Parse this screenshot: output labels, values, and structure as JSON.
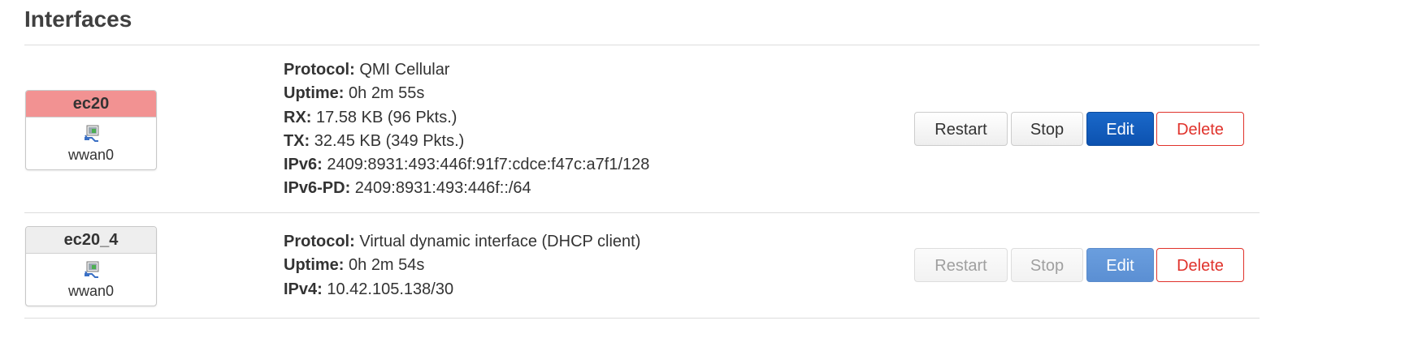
{
  "page": {
    "title": "Interfaces"
  },
  "interfaces": [
    {
      "name": "ec20",
      "device": "wwan0",
      "header_color": "#f29292",
      "icon": "network-adapter-icon",
      "details": [
        {
          "label": "Protocol:",
          "value": " QMI Cellular"
        },
        {
          "label": "Uptime:",
          "value": " 0h 2m 55s"
        },
        {
          "label": "RX:",
          "value": " 17.58 KB (96 Pkts.)"
        },
        {
          "label": "TX:",
          "value": " 32.45 KB (349 Pkts.)"
        },
        {
          "label": "IPv6:",
          "value": " 2409:8931:493:446f:91f7:cdce:f47c:a7f1/128"
        },
        {
          "label": "IPv6-PD:",
          "value": " 2409:8931:493:446f::/64"
        }
      ],
      "buttons": {
        "restart": "Restart",
        "stop": "Stop",
        "edit": "Edit",
        "delete": "Delete"
      },
      "buttons_disabled": false
    },
    {
      "name": "ec20_4",
      "device": "wwan0",
      "header_color": "#eeeeee",
      "icon": "network-adapter-icon",
      "details": [
        {
          "label": "Protocol:",
          "value": " Virtual dynamic interface (DHCP client)"
        },
        {
          "label": "Uptime:",
          "value": " 0h 2m 54s"
        },
        {
          "label": "IPv4:",
          "value": " 10.42.105.138/30"
        }
      ],
      "buttons": {
        "restart": "Restart",
        "stop": "Stop",
        "edit": "Edit",
        "delete": "Delete"
      },
      "buttons_disabled": true
    }
  ],
  "colors": {
    "edit_button": "#0c52b0",
    "delete_text": "#e0322b",
    "ec20_header": "#f29292"
  }
}
